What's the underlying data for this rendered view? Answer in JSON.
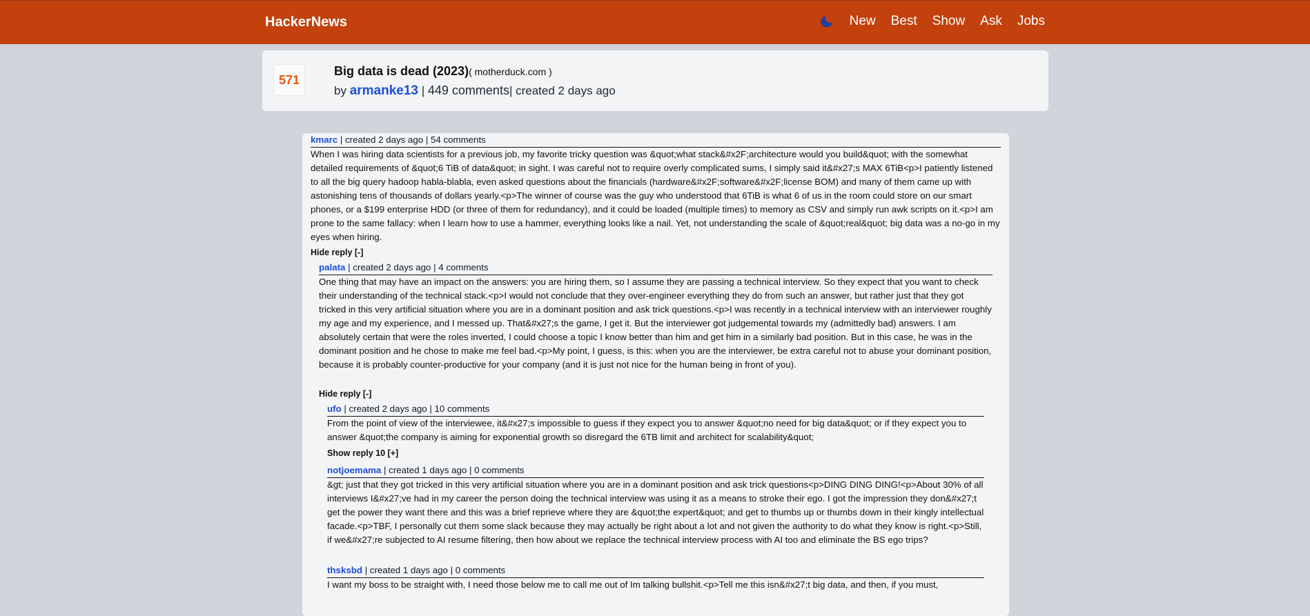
{
  "header": {
    "brand": "HackerNews",
    "nav": [
      "New",
      "Best",
      "Show",
      "Ask",
      "Jobs"
    ]
  },
  "story": {
    "score": "571",
    "title": "Big data is dead (2023)",
    "domain": "( motherduck.com )",
    "by": "by",
    "author": "armanke13",
    "comments": "449 comments",
    "created": "| created 2 days ago"
  },
  "comments": [
    {
      "user": "kmarc",
      "meta": "| created 2 days ago | 54 comments",
      "text": "When I was hiring data scientists for a previous job, my favorite tricky question was &quot;what stack&#x2F;architecture would you build&quot; with the somewhat detailed requirements of &quot;6 TiB of data&quot; in sight. I was careful not to require overly complicated sums, I simply said it&#x27;s MAX 6TiB<p>I patiently listened to all the big query hadoop habla-blabla, even asked questions about the financials (hardware&#x2F;software&#x2F;license BOM) and many of them came up with astonishing tens of thousands of dollars yearly.<p>The winner of course was the guy who understood that 6TiB is what 6 of us in the room could store on our smart phones, or a $199 enterprise HDD (or three of them for redundancy), and it could be loaded (multiple times) to memory as CSV and simply run awk scripts on it.<p>I am prone to the same fallacy: when I learn how to use a hammer, everything looks like a nail. Yet, not understanding the scale of &quot;real&quot; big data was a no-go in my eyes when hiring.",
      "toggle": "Hide reply [-]"
    },
    {
      "user": "palata",
      "meta": "| created 2 days ago | 4 comments",
      "text": "One thing that may have an impact on the answers: you are hiring them, so I assume they are passing a technical interview. So they expect that you want to check their understanding of the technical stack.<p>I would not conclude that they over-engineer everything they do from such an answer, but rather just that they got tricked in this very artificial situation where you are in a dominant position and ask trick questions.<p>I was recently in a technical interview with an interviewer roughly my age and my experience, and I messed up. That&#x27;s the game, I get it. But the interviewer got judgemental towards my (admittedly bad) answers. I am absolutely certain that were the roles inverted, I could choose a topic I know better than him and get him in a similarly bad position. But in this case, he was in the dominant position and he chose to make me feel bad.<p>My point, I guess, is this: when you are the interviewer, be extra careful not to abuse your dominant position, because it is probably counter-productive for your company (and it is just not nice for the human being in front of you).",
      "toggle": "Hide reply [-]"
    },
    {
      "user": "ufo",
      "meta": "| created 2 days ago | 10 comments",
      "text": "From the point of view of the interviewee, it&#x27;s impossible to guess if they expect you to answer &quot;no need for big data&quot; or if they expect you to answer &quot;the company is aiming for exponential growth so disregard the 6TB limit and architect for scalability&quot;",
      "toggle": "Show reply 10 [+]"
    },
    {
      "user": "notjoemama",
      "meta": "| created 1 days ago | 0 comments",
      "text": "&gt; just that they got tricked in this very artificial situation where you are in a dominant position and ask trick questions<p>DING DING DING!<p>About 30% of all interviews I&#x27;ve had in my career the person doing the technical interview was using it as a means to stroke their ego. I got the impression they don&#x27;t get the power they want there and this was a brief reprieve where they are &quot;the expert&quot; and get to thumbs up or thumbs down in their kingly intellectual facade.<p>TBF, I personally cut them some slack because they may actually be right about a lot and not given the authority to do what they know is right.<p>Still, if we&#x27;re subjected to AI resume filtering, then how about we replace the technical interview process with AI too and eliminate the BS ego trips?"
    },
    {
      "user": "thsksbd",
      "meta": "| created 1 days ago | 0 comments",
      "text": "I want my boss to be straight with, I need those below me to call me out of Im talking bullshit.<p>Tell me this isn&#x27;t big data, and then, if you must,"
    }
  ]
}
